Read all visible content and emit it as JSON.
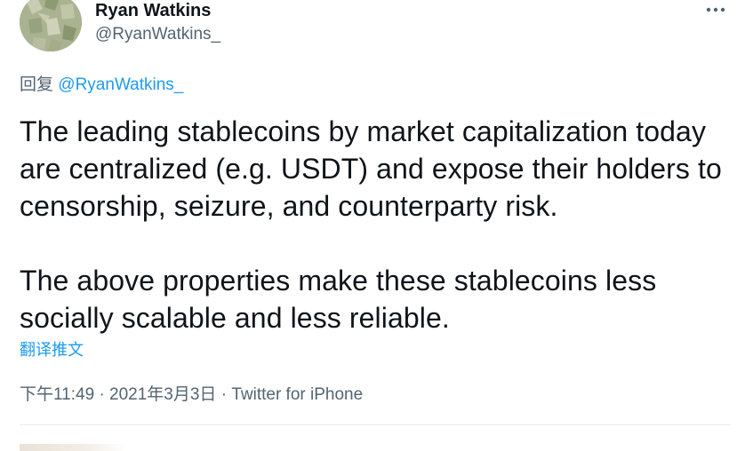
{
  "tweet": {
    "author": {
      "name": "Ryan Watkins",
      "handle": "@RyanWatkins_"
    },
    "reply": {
      "prefix": "回复",
      "mention": "@RyanWatkins_"
    },
    "paragraphs": [
      "The leading stablecoins by market capitalization today are centralized (e.g. USDT) and expose their holders to censorship, seizure, and counterparty risk.",
      "The above properties make these stablecoins less socially scalable and less reliable."
    ],
    "translate_label": "翻译推文",
    "time": "下午11:49",
    "separator1": "·",
    "date": "2021年3月3日",
    "separator2": "·",
    "source": "Twitter for iPhone",
    "more_icon": "more-horizontal-icon",
    "colors": {
      "link": "#1d9bf0",
      "muted": "#536471",
      "text": "#0f1419"
    }
  }
}
